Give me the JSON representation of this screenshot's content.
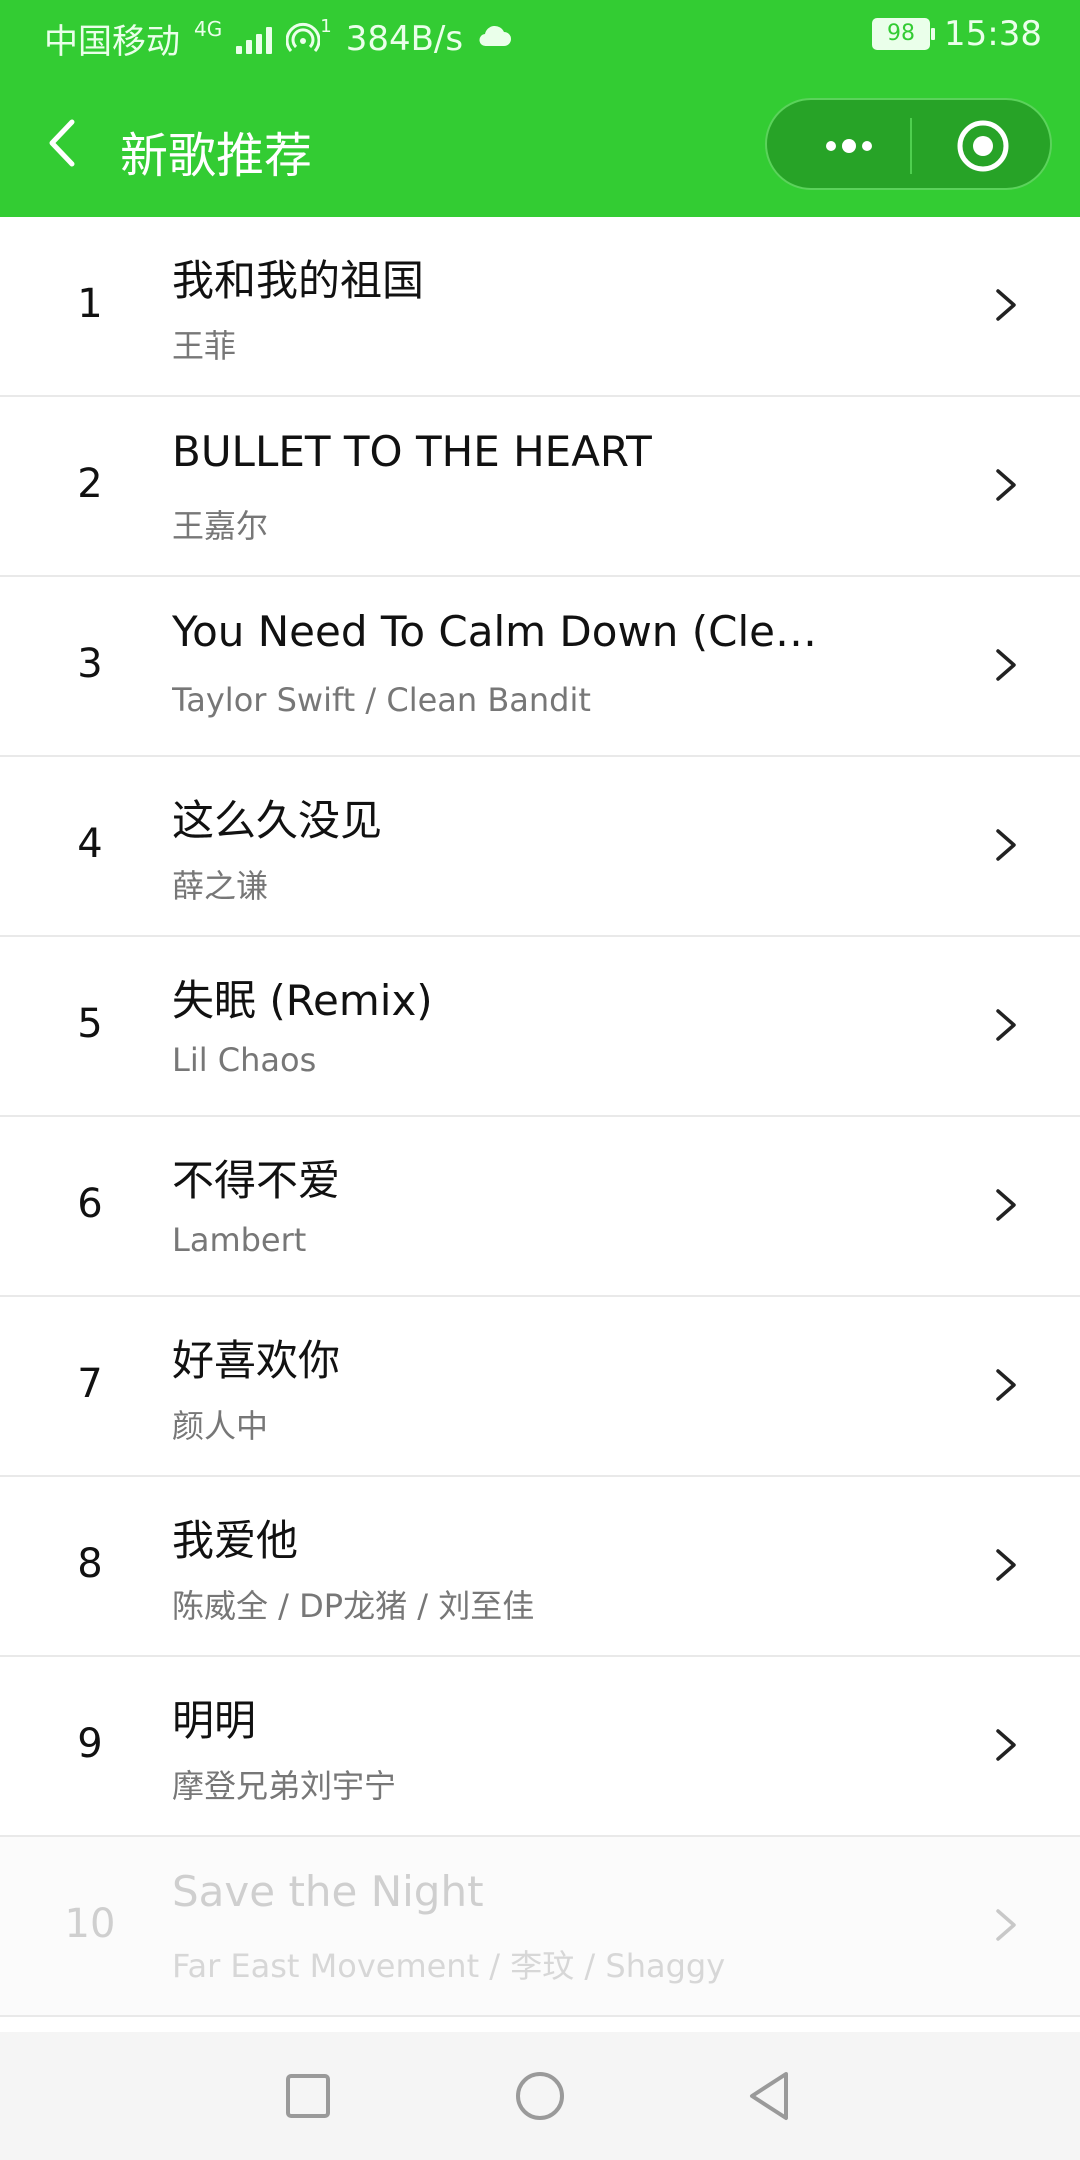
{
  "status_bar": {
    "carrier": "中国移动",
    "net_type": "4G",
    "hotspot_sup": "1",
    "speed": "384B/s",
    "battery": "98",
    "time": "15:38"
  },
  "nav": {
    "title": "新歌推荐"
  },
  "songs": [
    {
      "rank": "1",
      "title": "我和我的祖国",
      "artist": "王菲"
    },
    {
      "rank": "2",
      "title": "BULLET TO THE HEART",
      "artist": "王嘉尔"
    },
    {
      "rank": "3",
      "title": "You Need To Calm Down (Clea…",
      "artist": "Taylor Swift / Clean Bandit"
    },
    {
      "rank": "4",
      "title": "这么久没见",
      "artist": "薛之谦"
    },
    {
      "rank": "5",
      "title": "失眠 (Remix)",
      "artist": "Lil Chaos"
    },
    {
      "rank": "6",
      "title": "不得不爱",
      "artist": "Lambert"
    },
    {
      "rank": "7",
      "title": "好喜欢你",
      "artist": "颜人中"
    },
    {
      "rank": "8",
      "title": "我爱他",
      "artist": "陈威全 / DP龙猪 / 刘至佳"
    },
    {
      "rank": "9",
      "title": "明明",
      "artist": "摩登兄弟刘宇宁"
    },
    {
      "rank": "10",
      "title": "Save the Night",
      "artist": "Far East Movement / 李玟 / Shaggy"
    }
  ],
  "colors": {
    "header_green": "#33cc33",
    "capsule_green": "#27a327"
  }
}
